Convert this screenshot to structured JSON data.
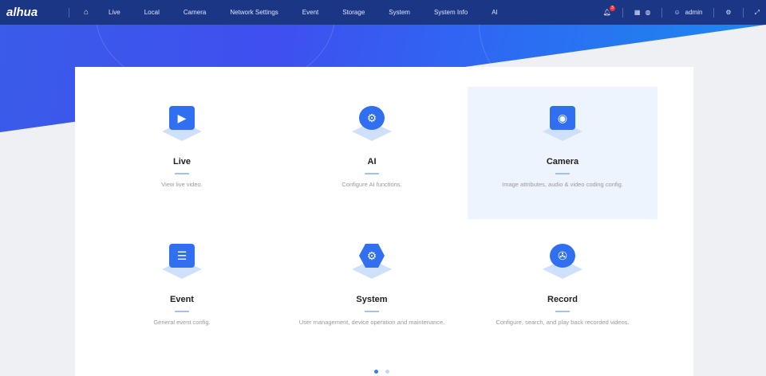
{
  "header": {
    "logo": "alhua",
    "nav": [
      "Live",
      "Local",
      "Camera",
      "Network Settings",
      "Event",
      "Storage",
      "System",
      "System Info",
      "AI"
    ],
    "notification_count": "3",
    "user": "admin"
  },
  "cards": [
    {
      "title": "Live",
      "desc": "View live video.",
      "icon": "▶"
    },
    {
      "title": "AI",
      "desc": "Configure AI functions.",
      "icon": "⚙"
    },
    {
      "title": "Camera",
      "desc": "Image attributes, audio & video coding config.",
      "icon": "◉"
    },
    {
      "title": "Event",
      "desc": "General event config.",
      "icon": "☰"
    },
    {
      "title": "System",
      "desc": "User management, device operation and maintenance.",
      "icon": "⚙"
    },
    {
      "title": "Record",
      "desc": "Configure, search, and play back recorded videos.",
      "icon": "✇"
    }
  ],
  "pagination": {
    "current": 1,
    "total": 2
  }
}
